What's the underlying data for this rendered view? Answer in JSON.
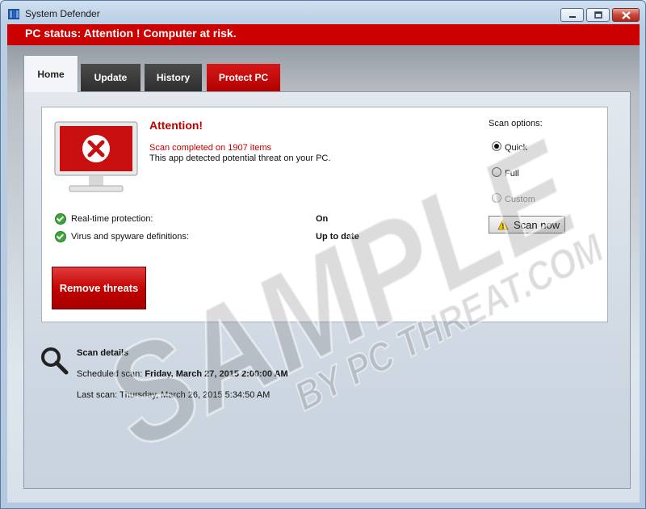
{
  "window": {
    "title": "System Defender",
    "app_icon": "shield-app-icon"
  },
  "status": {
    "text": "PC status: Attention ! Computer at risk.",
    "color": "#cc0000"
  },
  "tabs": [
    {
      "label": "Home",
      "active": true
    },
    {
      "label": "Update"
    },
    {
      "label": "History"
    },
    {
      "label": "Protect PC"
    }
  ],
  "main": {
    "attention": "Attention!",
    "scan_completed": "Scan completed on 1907 items",
    "detected": "This app detected potential threat on your PC.",
    "protection": [
      {
        "label": "Real-time protection:",
        "value": "On"
      },
      {
        "label": "Virus and spyware definitions:",
        "value": "Up to date"
      }
    ],
    "remove_button": "Remove threats"
  },
  "scan_options": {
    "title": "Scan options:",
    "options": [
      {
        "label": "Quick",
        "selected": true
      },
      {
        "label": "Full",
        "selected": false
      },
      {
        "label": "Custom",
        "selected": false,
        "disabled": true
      }
    ],
    "scan_button": "Scan now"
  },
  "scan_details": {
    "title": "Scan details",
    "scheduled_label": "Scheduled scan:",
    "scheduled_value": "Friday, March 27, 2015 2:00:00 AM",
    "last_label": "Last scan:",
    "last_value": "Thursday, March 26, 2015 5:34:50 AM"
  },
  "watermark": {
    "line1": "SAMPLE",
    "line2": "BY PC THREAT.COM"
  },
  "colors": {
    "alert_red": "#cc0000",
    "ok_green": "#3ea53a",
    "tab_dark": "#3a3a3a"
  }
}
